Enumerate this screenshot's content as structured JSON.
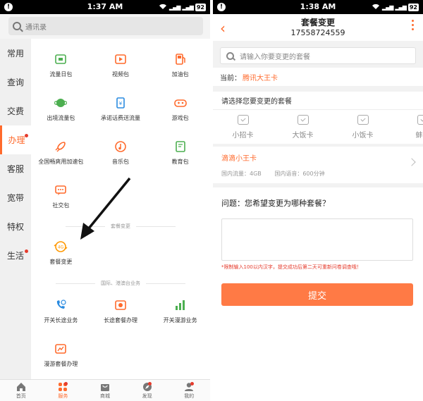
{
  "left": {
    "status": {
      "time": "1:37 AM",
      "battery": "92"
    },
    "search_placeholder": "通讯录",
    "sidebar": [
      {
        "label": "常用",
        "active": false,
        "dot": false
      },
      {
        "label": "查询",
        "active": false,
        "dot": false
      },
      {
        "label": "交费",
        "active": false,
        "dot": false
      },
      {
        "label": "办理",
        "active": true,
        "dot": true
      },
      {
        "label": "客服",
        "active": false,
        "dot": false
      },
      {
        "label": "宽带",
        "active": false,
        "dot": false
      },
      {
        "label": "特权",
        "active": false,
        "dot": false
      },
      {
        "label": "生活",
        "active": false,
        "dot": true
      }
    ],
    "packages": [
      {
        "label": "流量日包",
        "icon": "traffic-day-icon",
        "color": "#4caf50"
      },
      {
        "label": "视频包",
        "icon": "video-icon",
        "color": "#ff6a2c"
      },
      {
        "label": "加油包",
        "icon": "fuel-icon",
        "color": "#ff6a2c"
      },
      {
        "label": "出境流量包",
        "icon": "globe-icon",
        "color": "#4caf50"
      },
      {
        "label": "承诺话费送流量",
        "icon": "phone-card-icon",
        "color": "#2a8be0"
      },
      {
        "label": "游戏包",
        "icon": "gamepad-icon",
        "color": "#ff6a2c"
      },
      {
        "label": "全国畅爽用加速包",
        "icon": "rocket-icon",
        "color": "#ff6a2c"
      },
      {
        "label": "音乐包",
        "icon": "music-icon",
        "color": "#ff6a2c"
      },
      {
        "label": "教育包",
        "icon": "education-icon",
        "color": "#4caf50"
      },
      {
        "label": "社交包",
        "icon": "chat-icon",
        "color": "#ff6a2c"
      }
    ],
    "section_change": "套餐变更",
    "change_items": [
      {
        "label": "套餐变更",
        "icon": "plan-change-icon",
        "color": "#ff9800"
      }
    ],
    "section_intl": "国际、港澳台业务",
    "intl_items": [
      {
        "label": "开关长途业务",
        "icon": "long-distance-icon",
        "color": "#2a8be0"
      },
      {
        "label": "长途套餐办理",
        "icon": "long-distance-plan-icon",
        "color": "#ff6a2c"
      },
      {
        "label": "开关漫游业务",
        "icon": "roaming-icon",
        "color": "#4caf50"
      },
      {
        "label": "漫游套餐办理",
        "icon": "roaming-plan-icon",
        "color": "#ff6a2c"
      }
    ],
    "tabbar": [
      {
        "label": "首页",
        "icon": "home-icon",
        "active": false,
        "dot": false
      },
      {
        "label": "服务",
        "icon": "service-icon",
        "active": true,
        "dot": true
      },
      {
        "label": "商城",
        "icon": "mall-icon",
        "active": false,
        "dot": false
      },
      {
        "label": "发现",
        "icon": "discover-icon",
        "active": false,
        "dot": true
      },
      {
        "label": "我的",
        "icon": "profile-icon",
        "active": false,
        "dot": true
      }
    ]
  },
  "right": {
    "status": {
      "time": "1:38 AM",
      "battery": "92"
    },
    "title": "套餐变更",
    "phone": "17558724559",
    "search_placeholder": "请输入你要变更的套餐",
    "current_label": "当前：",
    "current_value": "腾讯大王卡",
    "choose_title": "请选择您要变更的套餐",
    "plans": [
      "小招卡",
      "大饭卡",
      "小饭卡",
      "蚌王"
    ],
    "selected": {
      "name": "滴滴小王卡",
      "domestic_data": "国内流量：4GB",
      "domestic_voice": "国内语音：600分钟"
    },
    "question": "问题：您希望变更为哪种套餐？",
    "warning": "*限制输入100以内汉字，提交成功后第二天可重新问卷调查哦！",
    "submit": "提交"
  },
  "colors": {
    "accent": "#ff6a2c",
    "alert_red": "#e53b2c"
  }
}
